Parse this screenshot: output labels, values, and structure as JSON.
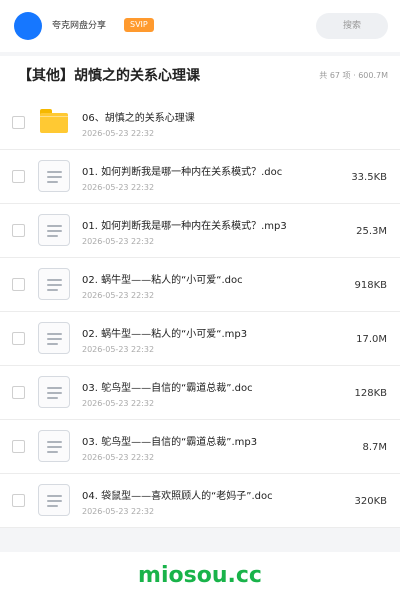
{
  "header": {
    "site_name": "夸克网盘分享",
    "badge": "SVIP",
    "search_placeholder": "搜索"
  },
  "folder": {
    "title": "【其他】胡慎之的关系心理课",
    "meta": "共 67 项 · 600.7M"
  },
  "files": [
    {
      "type": "folder",
      "name": "06、胡慎之的关系心理课",
      "date": "2026-05-23 22:32",
      "size": ""
    },
    {
      "type": "doc",
      "name": "01. 如何判断我是哪一种内在关系模式？.doc",
      "date": "2026-05-23 22:32",
      "size": "33.5KB"
    },
    {
      "type": "doc",
      "name": "01. 如何判断我是哪一种内在关系模式？.mp3",
      "date": "2026-05-23 22:32",
      "size": "25.3M"
    },
    {
      "type": "doc",
      "name": "02. 蜗牛型——粘人的“小可爱“.doc",
      "date": "2026-05-23 22:32",
      "size": "918KB"
    },
    {
      "type": "doc",
      "name": "02. 蜗牛型——粘人的“小可爱“.mp3",
      "date": "2026-05-23 22:32",
      "size": "17.0M"
    },
    {
      "type": "doc",
      "name": "03. 鸵鸟型——自信的“霸道总裁”.doc",
      "date": "2026-05-23 22:32",
      "size": "128KB"
    },
    {
      "type": "doc",
      "name": "03. 鸵鸟型——自信的“霸道总裁”.mp3",
      "date": "2026-05-23 22:32",
      "size": "8.7M"
    },
    {
      "type": "doc",
      "name": "04. 袋鼠型——喜欢照顾人的“老妈子”.doc",
      "date": "2026-05-23 22:32",
      "size": "320KB"
    }
  ],
  "footer": {
    "brand": "miosou.cc"
  },
  "colors": {
    "accent": "#1677ff",
    "badge": "#ff9a2e",
    "folder": "#ffc933",
    "brand": "#19b34a"
  }
}
